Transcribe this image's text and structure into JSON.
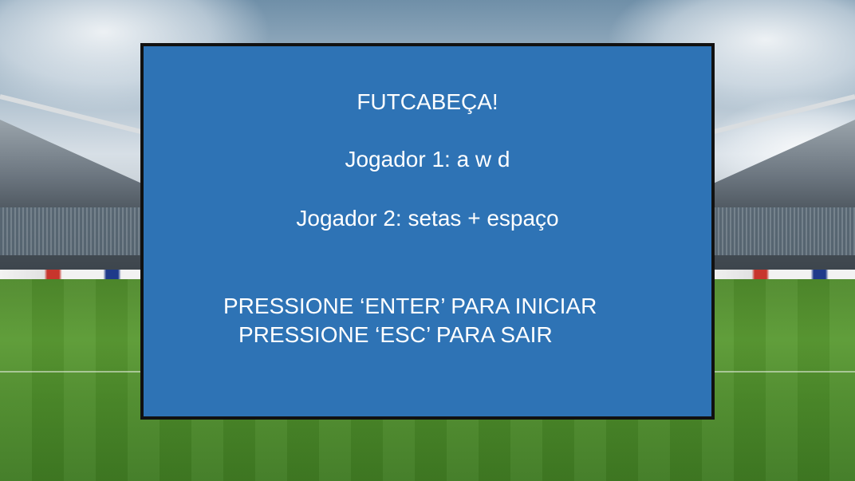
{
  "menu": {
    "title": "FUTCABEÇA!",
    "player1_controls": "Jogador 1: a w d",
    "player2_controls": "Jogador 2: setas + espaço",
    "start_prompt": "PRESSIONE ‘ENTER’ PARA INICIAR",
    "exit_prompt": "PRESSIONE ‘ESC’ PARA SAIR"
  },
  "colors": {
    "panel_background": "#2e73b5",
    "panel_border": "#111111",
    "text": "#ffffff"
  }
}
